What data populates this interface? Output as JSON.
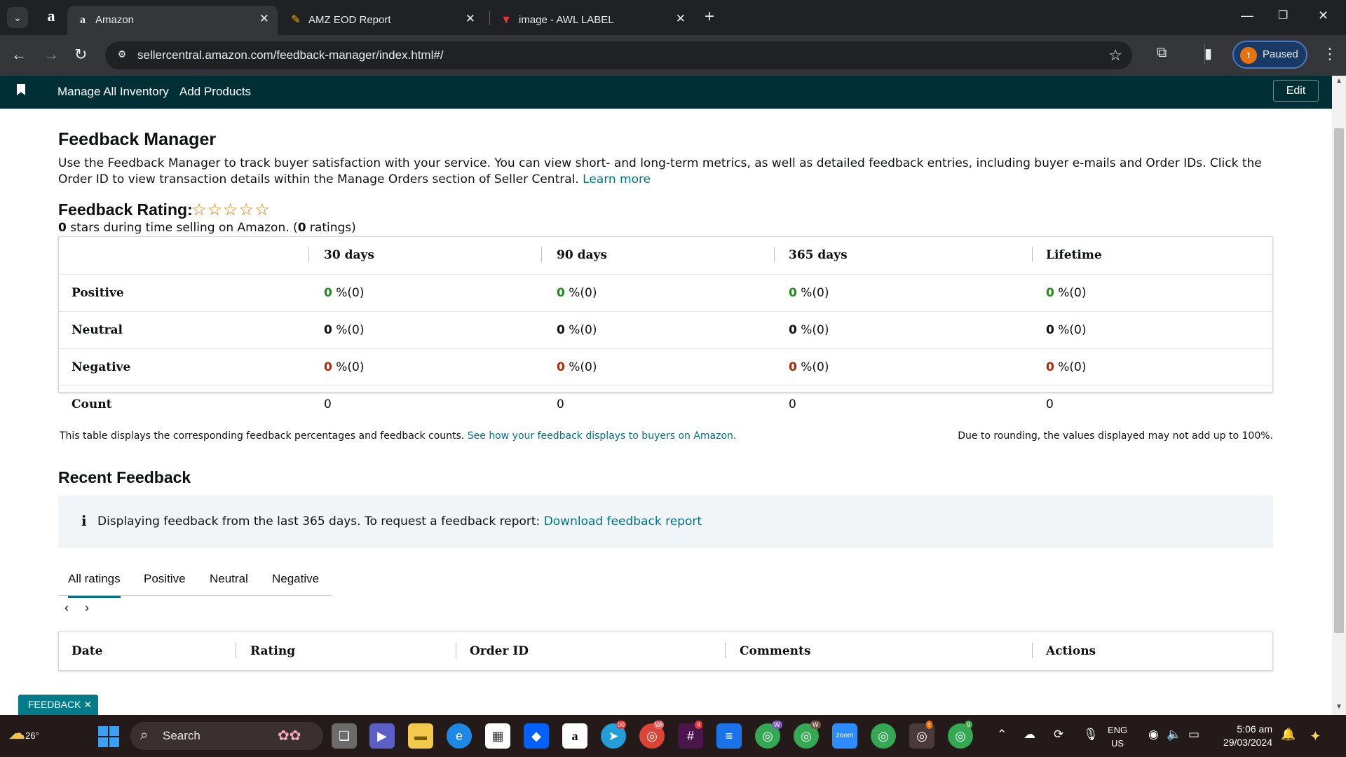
{
  "browser": {
    "tabs": [
      {
        "title": "Amazon",
        "active": true
      },
      {
        "title": "AMZ EOD Report",
        "active": false
      },
      {
        "title": "image - AWL LABEL",
        "active": false
      }
    ],
    "url": "sellercentral.amazon.com/feedback-manager/index.html#/",
    "profile_initial": "t",
    "profile_label": "Paused"
  },
  "sc_nav": {
    "links": [
      "Manage All Inventory",
      "Add Products"
    ],
    "edit_label": "Edit"
  },
  "page": {
    "title": "Feedback Manager",
    "intro": "Use the Feedback Manager to track buyer satisfaction with your service. You can view short- and long-term metrics, as well as detailed feedback entries, including buyer e-mails and Order IDs. Click the Order ID to view transaction details within the Manage Orders section of Seller Central.",
    "intro_link": "Learn more",
    "rating_title": "Feedback Rating:",
    "stars": "☆☆☆☆☆",
    "rating_count": "0",
    "rating_sub_a": " stars during time selling on Amazon. (",
    "rating_ratings": "0",
    "rating_sub_b": " ratings)",
    "table": {
      "columns": [
        "30 days",
        "90 days",
        "365 days",
        "Lifetime"
      ],
      "rows": [
        {
          "label": "Positive",
          "values": [
            "0",
            "0",
            "0",
            "0"
          ],
          "suffix": "%(0)"
        },
        {
          "label": "Neutral",
          "values": [
            "0",
            "0",
            "0",
            "0"
          ],
          "suffix": "%(0)"
        },
        {
          "label": "Negative",
          "values": [
            "0",
            "0",
            "0",
            "0"
          ],
          "suffix": "%(0)"
        },
        {
          "label": "Count",
          "values": [
            "0",
            "0",
            "0",
            "0"
          ],
          "suffix": ""
        }
      ]
    },
    "table_note": "This table displays the corresponding feedback percentages and feedback counts.",
    "table_note_link": "See how your feedback displays to buyers on Amazon.",
    "table_note_right": "Due to rounding, the values displayed may not add up to 100%.",
    "recent_title": "Recent Feedback",
    "info_icon": "i",
    "info_text": "Displaying feedback from the last 365 days. To request a feedback report:",
    "info_link": "Download feedback report",
    "filter_tabs": [
      "All ratings",
      "Positive",
      "Neutral",
      "Negative"
    ],
    "recent_columns": [
      "Date",
      "Rating",
      "Order ID",
      "Comments",
      "Actions"
    ],
    "feedback_tag": "FEEDBACK"
  },
  "taskbar": {
    "temperature": "26°",
    "search_label": "Search",
    "lang_line1": "ENG",
    "lang_line2": "US",
    "time": "5:06 am",
    "date": "29/03/2024",
    "badges": {
      "va": "VA",
      "telegram": "00",
      "slack": "4",
      "chrome_w1": "W",
      "chrome_w2": "W",
      "chrome_t": "t",
      "chrome_9": "9"
    }
  },
  "colors": {
    "nav_bg": "#002f36",
    "link": "#007185",
    "positive": "#1e8e17",
    "negative": "#b12704",
    "star": "#e77600"
  }
}
